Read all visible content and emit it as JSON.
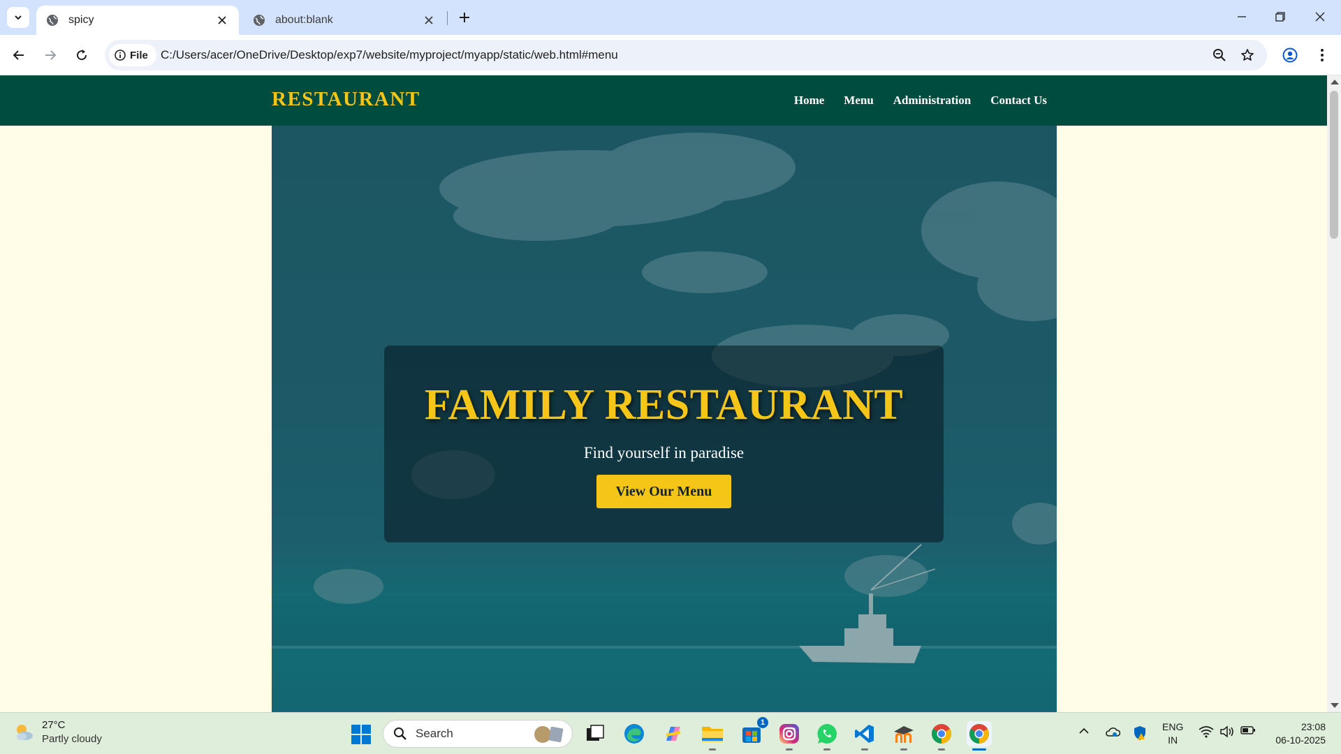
{
  "browser": {
    "tabs": [
      {
        "title": "spicy",
        "active": true
      },
      {
        "title": "about:blank",
        "active": false
      }
    ],
    "address_chip": "File",
    "url": "C:/Users/acer/OneDrive/Desktop/exp7/website/myproject/myapp/static/web.html#menu"
  },
  "site": {
    "brand": "RESTAURANT",
    "nav": [
      "Home",
      "Menu",
      "Administration",
      "Contact Us"
    ],
    "hero": {
      "title": "FAMILY RESTAURANT",
      "subtitle": "Find yourself in paradise",
      "button": "View Our Menu"
    },
    "colors": {
      "nav_bg": "#004d40",
      "accent": "#f5c518",
      "page_bg": "#fffde7"
    }
  },
  "taskbar": {
    "weather": {
      "temp": "27°C",
      "condition": "Partly cloudy"
    },
    "search_placeholder": "Search",
    "store_badge": "1",
    "language": {
      "line1": "ENG",
      "line2": "IN"
    },
    "clock": {
      "time": "23:08",
      "date": "06-10-2025"
    },
    "apps": [
      "task-view-icon",
      "edge-icon",
      "copilot-icon",
      "file-explorer-icon",
      "microsoft-store-icon",
      "instagram-icon",
      "whatsapp-icon",
      "vscode-icon",
      "moodle-icon",
      "chrome-icon",
      "chrome-icon"
    ]
  }
}
